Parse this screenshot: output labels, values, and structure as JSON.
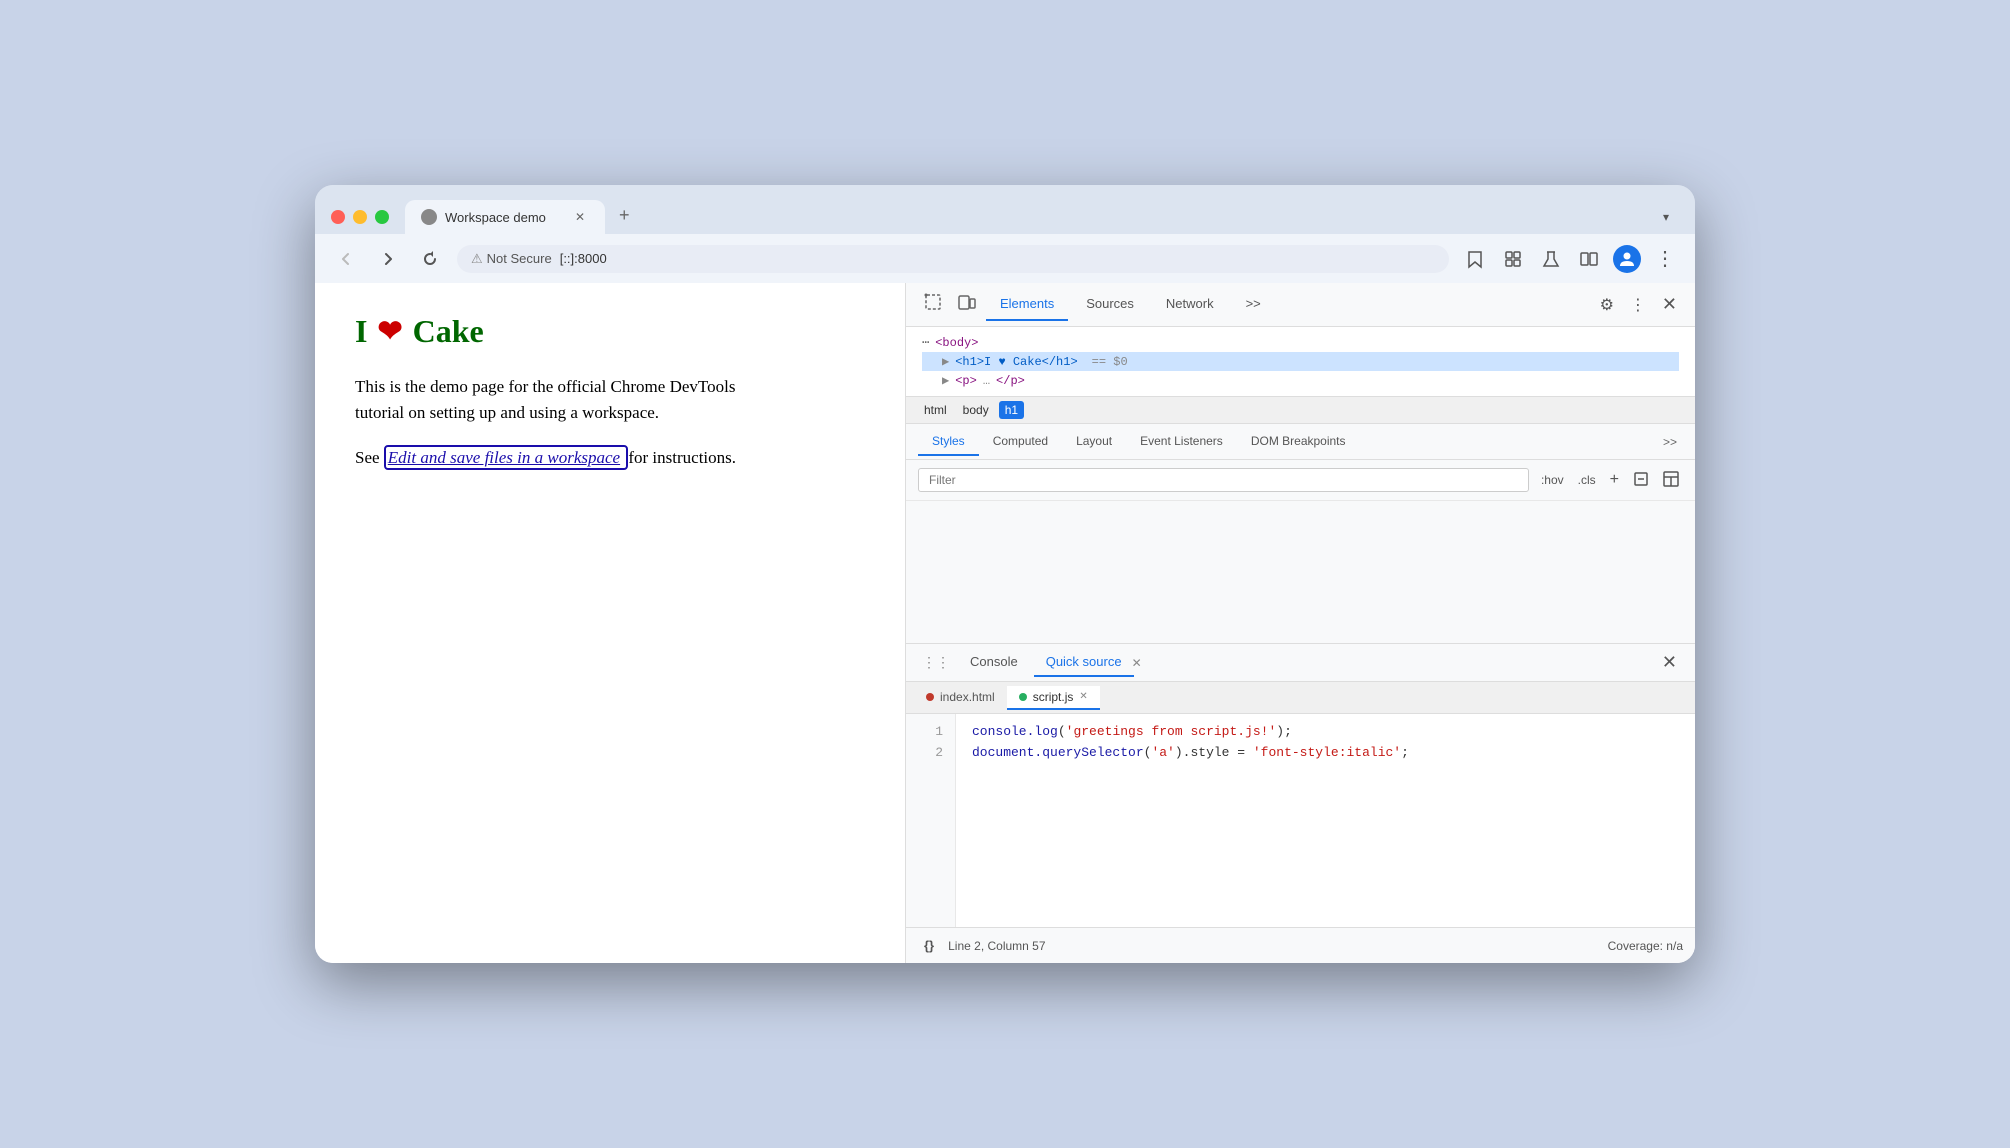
{
  "browser": {
    "tab_title": "Workspace demo",
    "tab_favicon": "⊙",
    "new_tab_label": "+",
    "dropdown_label": "▾",
    "nav": {
      "back_label": "←",
      "forward_label": "→",
      "reload_label": "↺"
    },
    "addressbar": {
      "security_label": "Not Secure",
      "url": "[::]:8000"
    },
    "toolbar": {
      "bookmark_icon": "☆",
      "extensions_icon": "⬜",
      "lab_icon": "⚗",
      "split_icon": "⬛",
      "profile_icon": "👤",
      "menu_icon": "⋮"
    }
  },
  "webpage": {
    "heading_prefix": "I",
    "heading_cake": "Cake",
    "body_text": "This is the demo page for the official Chrome DevTools tutorial on setting up and using a workspace.",
    "see_text_before": "See",
    "link_text": "Edit and save files in a workspace",
    "see_text_after": "for instructions."
  },
  "devtools": {
    "tabs": [
      {
        "label": "Elements",
        "active": true
      },
      {
        "label": "Sources",
        "active": false
      },
      {
        "label": "Network",
        "active": false
      }
    ],
    "more_tabs_label": ">>",
    "settings_icon": "⚙",
    "more_options_icon": "⋮",
    "close_icon": "✕",
    "inspect_icon": "⊡",
    "device_icon": "⬜",
    "dom": {
      "body_tag": "<body>",
      "h1_line": "<h1>I ♥ Cake</h1>",
      "h1_selected": "== $0",
      "p_tag": "<p> </p>",
      "ellipsis": "⋯"
    },
    "breadcrumb": [
      "html",
      "body",
      "h1"
    ],
    "styles_tabs": [
      {
        "label": "Styles",
        "active": true
      },
      {
        "label": "Computed",
        "active": false
      },
      {
        "label": "Layout",
        "active": false
      },
      {
        "label": "Event Listeners",
        "active": false
      },
      {
        "label": "DOM Breakpoints",
        "active": false
      }
    ],
    "styles_more_label": ">>",
    "filter_placeholder": "Filter",
    "filter_hov_label": ":hov",
    "filter_cls_label": ".cls",
    "filter_add_label": "+",
    "filter_force_label": "⊟",
    "filter_layout_label": "⊞",
    "bottom_panel": {
      "drag_icon": "⠿",
      "tabs": [
        {
          "label": "Console",
          "active": false,
          "closable": false
        },
        {
          "label": "Quick source",
          "active": true,
          "closable": true
        }
      ],
      "close_icon": "✕"
    },
    "file_tabs": [
      {
        "label": "index.html",
        "dot_color": "#c0392b",
        "active": false,
        "closable": false
      },
      {
        "label": "script.js",
        "dot_color": "#27ae60",
        "active": true,
        "closable": true
      }
    ],
    "code_lines": [
      {
        "number": "1",
        "parts": [
          {
            "type": "func",
            "text": "console.log"
          },
          {
            "type": "punct",
            "text": "("
          },
          {
            "type": "string",
            "text": "'greetings from script.js!'"
          },
          {
            "type": "punct",
            "text": ");"
          }
        ]
      },
      {
        "number": "2",
        "parts": [
          {
            "type": "func",
            "text": "document.querySelector"
          },
          {
            "type": "punct",
            "text": "("
          },
          {
            "type": "string",
            "text": "'a'"
          },
          {
            "type": "punct",
            "text": ").style = "
          },
          {
            "type": "string",
            "text": "'font-style:italic'"
          },
          {
            "type": "punct",
            "text": ";"
          }
        ]
      }
    ],
    "status_bar": {
      "format_icon": "{}",
      "position": "Line 2, Column 57",
      "coverage": "Coverage: n/a"
    }
  }
}
